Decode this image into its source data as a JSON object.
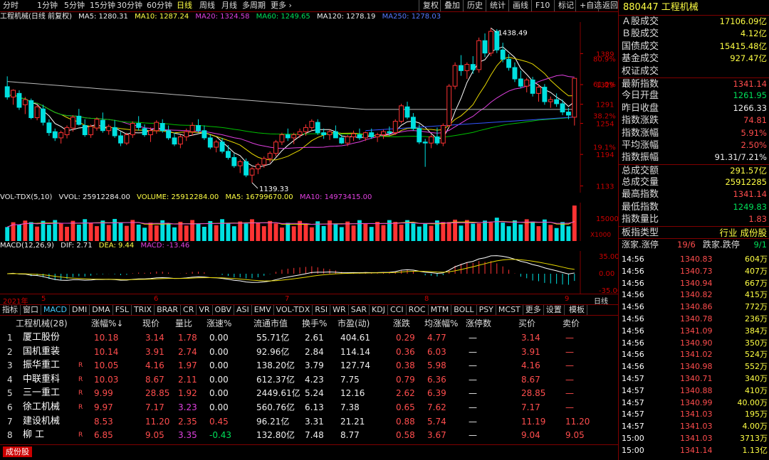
{
  "toolbar": {
    "periods": [
      "分时",
      "1分钟",
      "5分钟",
      "15分钟",
      "30分钟",
      "60分钟",
      "日线",
      "周线",
      "月线",
      "多周期",
      "更多 ›"
    ],
    "buttons": [
      "复权",
      "叠加",
      "历史",
      "统计",
      "画线",
      "F10",
      "标记",
      "+自选",
      "返回"
    ]
  },
  "kline": {
    "title": "工程机械(日线 前复权)",
    "ma5": "MA5: 1280.31",
    "ma10": "MA10: 1287.24",
    "ma20": "MA20: 1324.58",
    "ma60": "MA60: 1249.65",
    "ma120": "MA120: 1278.19",
    "ma250": "MA250: 1278.03",
    "high_label": "1438.49",
    "low_label": "1139.33",
    "price_axis": [
      "1389",
      "1329",
      "1291",
      "1254",
      "1194",
      "1133"
    ],
    "pct_axis": [
      "80.9%",
      "61.8%",
      "38.2%",
      "19.1%"
    ]
  },
  "volume": {
    "label": "VOL-TDX(5,10)",
    "vvol": "VVOL: 25912284.00",
    "volume": "VOLUME: 25912284.00",
    "ma5": "MA5: 16799670.00",
    "ma10": "MA10: 14973415.00",
    "axis": "15000",
    "unit": "X1000"
  },
  "macd": {
    "label": "MACD(12,26,9)",
    "dif": "DIF: 2.71",
    "dea": "DEA: 9.44",
    "macd": "MACD: -13.46",
    "axis": [
      "35.00",
      "0.00",
      "-35.00"
    ]
  },
  "date_axis": [
    "2021年",
    "5",
    "6",
    "7",
    "8",
    "9"
  ],
  "bottom_right_label": "日线",
  "indicator_tabs": [
    "指标",
    "窗口",
    "MACD",
    "DMI",
    "DMA",
    "FSL",
    "TRIX",
    "BRAR",
    "CR",
    "VR",
    "OBV",
    "ASI",
    "EMV",
    "VOL-TDX",
    "RSI",
    "WR",
    "SAR",
    "KDJ",
    "CCI",
    "ROC",
    "MTM",
    "BOLL",
    "PSY",
    "MCST",
    "更多",
    "设置"
  ],
  "indicator_tab_extra": "模板",
  "table": {
    "headers": [
      "工程机械(28)",
      "涨幅%↓",
      "现价",
      "量比",
      "涨速%",
      "流通市值",
      "换手%",
      "市盈(动)",
      "涨跌",
      "均涨幅%",
      "涨停数",
      "买价",
      "卖价"
    ],
    "rows": [
      {
        "no": "1",
        "name": "厦工股份",
        "r": "",
        "chg": "10.18",
        "price": "3.14",
        "vr": "1.78",
        "spd": "0.00",
        "cap": "55.71亿",
        "turn": "2.61",
        "pe": "404.61",
        "diff": "0.29",
        "avg": "4.77",
        "lim": "—",
        "bid": "3.14",
        "ask": "—"
      },
      {
        "no": "2",
        "name": "国机重装",
        "r": "",
        "chg": "10.14",
        "price": "3.91",
        "vr": "2.74",
        "spd": "0.00",
        "cap": "92.96亿",
        "turn": "2.84",
        "pe": "114.14",
        "diff": "0.36",
        "avg": "6.03",
        "lim": "—",
        "bid": "3.91",
        "ask": "—"
      },
      {
        "no": "3",
        "name": "振华重工",
        "r": "R",
        "chg": "10.05",
        "price": "4.16",
        "vr": "1.97",
        "spd": "0.00",
        "cap": "138.20亿",
        "turn": "3.79",
        "pe": "127.74",
        "diff": "0.38",
        "avg": "5.98",
        "lim": "—",
        "bid": "4.16",
        "ask": "—"
      },
      {
        "no": "4",
        "name": "中联重科",
        "r": "R",
        "chg": "10.03",
        "price": "8.67",
        "vr": "2.11",
        "spd": "0.00",
        "cap": "612.37亿",
        "turn": "4.23",
        "pe": "7.75",
        "diff": "0.79",
        "avg": "6.36",
        "lim": "—",
        "bid": "8.67",
        "ask": "—"
      },
      {
        "no": "5",
        "name": "三一重工",
        "r": "R",
        "chg": "9.99",
        "price": "28.85",
        "vr": "1.92",
        "spd": "0.00",
        "cap": "2449.61亿",
        "turn": "5.24",
        "pe": "12.16",
        "diff": "2.62",
        "avg": "6.39",
        "lim": "—",
        "bid": "28.85",
        "ask": "—"
      },
      {
        "no": "6",
        "name": "徐工机械",
        "r": "R",
        "chg": "9.97",
        "price": "7.17",
        "vr": "3.23",
        "spd": "0.00",
        "cap": "560.76亿",
        "turn": "6.13",
        "pe": "7.38",
        "diff": "0.65",
        "avg": "7.62",
        "lim": "—",
        "bid": "7.17",
        "ask": "—"
      },
      {
        "no": "7",
        "name": "建设机械",
        "r": "",
        "chg": "8.53",
        "price": "11.20",
        "vr": "2.35",
        "spd": "0.45",
        "cap": "96.21亿",
        "turn": "3.31",
        "pe": "21.21",
        "diff": "0.88",
        "avg": "5.74",
        "lim": "—",
        "bid": "11.19",
        "ask": "11.20"
      },
      {
        "no": "8",
        "name": "柳  工",
        "r": "R",
        "chg": "6.85",
        "price": "9.05",
        "vr": "3.35",
        "spd": "-0.43",
        "cap": "132.80亿",
        "turn": "7.48",
        "pe": "8.77",
        "diff": "0.58",
        "avg": "3.67",
        "lim": "—",
        "bid": "9.04",
        "ask": "9.05"
      }
    ]
  },
  "bottom_tag": "成份股",
  "right_panel": {
    "title": "880447 工程机械",
    "stats": [
      {
        "label": "Ａ股成交",
        "value": "17106.09亿",
        "color": "y"
      },
      {
        "label": "Ｂ股成交",
        "value": "4.12亿",
        "color": "y"
      },
      {
        "label": "国债成交",
        "value": "15415.48亿",
        "color": "y"
      },
      {
        "label": "基金成交",
        "value": "927.47亿",
        "color": "y"
      },
      {
        "label": "权证成交",
        "value": "",
        "color": "y"
      },
      {
        "label": "最新指数",
        "value": "1341.14",
        "color": "r"
      },
      {
        "label": "今日开盘",
        "value": "1261.95",
        "color": "g"
      },
      {
        "label": "昨日收盘",
        "value": "1266.33",
        "color": "w"
      },
      {
        "label": "指数涨跌",
        "value": "74.81",
        "color": "r"
      },
      {
        "label": "指数涨幅",
        "value": "5.91%",
        "color": "r"
      },
      {
        "label": "平均涨幅",
        "value": "2.50%",
        "color": "r"
      },
      {
        "label": "指数振幅",
        "value": "91.31/7.21%",
        "color": "w"
      },
      {
        "label": "总成交额",
        "value": "291.57亿",
        "color": "y"
      },
      {
        "label": "总成交量",
        "value": "25912285",
        "color": "y"
      },
      {
        "label": "最高指数",
        "value": "1341.14",
        "color": "r"
      },
      {
        "label": "最低指数",
        "value": "1249.83",
        "color": "g"
      },
      {
        "label": "指数量比",
        "value": "1.83",
        "color": "r"
      }
    ],
    "board_label": "板指类型",
    "board_value": "行业 成份股",
    "updown": {
      "up_label": "涨家.涨停",
      "up_value": "19/6",
      "down_label": "跌家.跌停",
      "down_value": "9/1"
    },
    "ticks": [
      {
        "time": "14:56",
        "price": "1340.83",
        "vol": "604万"
      },
      {
        "time": "14:56",
        "price": "1340.73",
        "vol": "407万"
      },
      {
        "time": "14:56",
        "price": "1340.94",
        "vol": "667万"
      },
      {
        "time": "14:56",
        "price": "1340.82",
        "vol": "415万"
      },
      {
        "time": "14:56",
        "price": "1340.86",
        "vol": "772万"
      },
      {
        "time": "14:56",
        "price": "1340.78",
        "vol": "236万"
      },
      {
        "time": "14:56",
        "price": "1341.09",
        "vol": "384万"
      },
      {
        "time": "14:56",
        "price": "1340.90",
        "vol": "350万"
      },
      {
        "time": "14:56",
        "price": "1341.02",
        "vol": "524万"
      },
      {
        "time": "14:56",
        "price": "1340.98",
        "vol": "552万"
      },
      {
        "time": "14:57",
        "price": "1340.71",
        "vol": "340万"
      },
      {
        "time": "14:57",
        "price": "1340.88",
        "vol": "410万"
      },
      {
        "time": "14:57",
        "price": "1340.99",
        "vol": "40.00万"
      },
      {
        "time": "14:57",
        "price": "1341.03",
        "vol": "195万"
      },
      {
        "time": "14:57",
        "price": "1341.03",
        "vol": "4.00万"
      },
      {
        "time": "15:00",
        "price": "1341.03",
        "vol": "3713万"
      },
      {
        "time": "15:00",
        "price": "1341.14",
        "vol": "1.13亿"
      }
    ]
  },
  "chart_data": {
    "type": "candlestick",
    "title": "工程机械(日线 前复权)",
    "ylim": [
      1120,
      1450
    ],
    "high": 1438.49,
    "low": 1139.33,
    "ohlc": [
      [
        1325,
        1345,
        1300,
        1305
      ],
      [
        1305,
        1320,
        1290,
        1318
      ],
      [
        1312,
        1318,
        1280,
        1285
      ],
      [
        1290,
        1305,
        1272,
        1300
      ],
      [
        1298,
        1302,
        1262,
        1265
      ],
      [
        1265,
        1290,
        1260,
        1286
      ],
      [
        1282,
        1290,
        1250,
        1256
      ],
      [
        1255,
        1262,
        1230,
        1236
      ],
      [
        1238,
        1244,
        1220,
        1226
      ],
      [
        1226,
        1240,
        1215,
        1236
      ],
      [
        1232,
        1250,
        1225,
        1246
      ],
      [
        1245,
        1270,
        1238,
        1266
      ],
      [
        1268,
        1282,
        1250,
        1252
      ],
      [
        1250,
        1262,
        1228,
        1232
      ],
      [
        1232,
        1252,
        1226,
        1248
      ],
      [
        1245,
        1266,
        1240,
        1262
      ],
      [
        1260,
        1275,
        1236,
        1240
      ],
      [
        1240,
        1252,
        1232,
        1248
      ],
      [
        1246,
        1260,
        1226,
        1230
      ],
      [
        1230,
        1238,
        1210,
        1216
      ],
      [
        1216,
        1236,
        1212,
        1232
      ],
      [
        1232,
        1258,
        1226,
        1254
      ],
      [
        1254,
        1268,
        1240,
        1246
      ],
      [
        1244,
        1252,
        1228,
        1232
      ],
      [
        1232,
        1246,
        1218,
        1240
      ],
      [
        1240,
        1260,
        1234,
        1256
      ],
      [
        1254,
        1262,
        1236,
        1240
      ],
      [
        1240,
        1250,
        1222,
        1226
      ],
      [
        1226,
        1236,
        1210,
        1214
      ],
      [
        1214,
        1232,
        1206,
        1228
      ],
      [
        1228,
        1244,
        1220,
        1238
      ],
      [
        1238,
        1256,
        1230,
        1250
      ],
      [
        1250,
        1262,
        1236,
        1240
      ],
      [
        1240,
        1250,
        1222,
        1226
      ],
      [
        1226,
        1232,
        1204,
        1208
      ],
      [
        1208,
        1222,
        1198,
        1218
      ],
      [
        1218,
        1226,
        1196,
        1200
      ],
      [
        1200,
        1212,
        1184,
        1188
      ],
      [
        1188,
        1196,
        1168,
        1172
      ],
      [
        1172,
        1184,
        1158,
        1180
      ],
      [
        1180,
        1186,
        1150,
        1154
      ],
      [
        1154,
        1170,
        1139.33,
        1166
      ],
      [
        1166,
        1178,
        1156,
        1174
      ],
      [
        1174,
        1190,
        1168,
        1186
      ],
      [
        1186,
        1200,
        1178,
        1196
      ],
      [
        1196,
        1222,
        1190,
        1218
      ],
      [
        1218,
        1236,
        1212,
        1232
      ],
      [
        1232,
        1244,
        1220,
        1226
      ],
      [
        1226,
        1236,
        1214,
        1232
      ],
      [
        1232,
        1244,
        1226,
        1238
      ],
      [
        1238,
        1252,
        1230,
        1246
      ],
      [
        1246,
        1262,
        1240,
        1258
      ],
      [
        1256,
        1262,
        1232,
        1236
      ],
      [
        1236,
        1244,
        1224,
        1232
      ],
      [
        1232,
        1242,
        1222,
        1238
      ],
      [
        1238,
        1250,
        1230,
        1226
      ],
      [
        1226,
        1232,
        1214,
        1216
      ],
      [
        1216,
        1232,
        1210,
        1228
      ],
      [
        1228,
        1240,
        1220,
        1234
      ],
      [
        1232,
        1244,
        1222,
        1226
      ],
      [
        1226,
        1238,
        1220,
        1236
      ],
      [
        1236,
        1244,
        1224,
        1228
      ],
      [
        1228,
        1236,
        1218,
        1232
      ],
      [
        1232,
        1242,
        1224,
        1238
      ],
      [
        1238,
        1248,
        1230,
        1236
      ],
      [
        1236,
        1262,
        1232,
        1258
      ],
      [
        1258,
        1292,
        1254,
        1288
      ],
      [
        1286,
        1296,
        1262,
        1266
      ],
      [
        1266,
        1274,
        1240,
        1244
      ],
      [
        1244,
        1252,
        1214,
        1218
      ],
      [
        1218,
        1224,
        1170,
        1216
      ],
      [
        1216,
        1232,
        1206,
        1228
      ],
      [
        1228,
        1246,
        1212,
        1216
      ],
      [
        1216,
        1254,
        1210,
        1250
      ],
      [
        1250,
        1330,
        1246,
        1326
      ],
      [
        1326,
        1372,
        1320,
        1366
      ],
      [
        1366,
        1386,
        1346,
        1356
      ],
      [
        1356,
        1372,
        1340,
        1368
      ],
      [
        1368,
        1384,
        1350,
        1358
      ],
      [
        1358,
        1420,
        1352,
        1414
      ],
      [
        1414,
        1428,
        1382,
        1390
      ],
      [
        1390,
        1438.49,
        1384,
        1432
      ],
      [
        1432,
        1436,
        1390,
        1396
      ],
      [
        1396,
        1410,
        1372,
        1378
      ],
      [
        1378,
        1388,
        1356,
        1362
      ],
      [
        1362,
        1372,
        1334,
        1340
      ],
      [
        1340,
        1356,
        1322,
        1326
      ],
      [
        1326,
        1342,
        1314,
        1338
      ],
      [
        1338,
        1344,
        1306,
        1312
      ],
      [
        1312,
        1330,
        1296,
        1324
      ],
      [
        1324,
        1330,
        1290,
        1296
      ],
      [
        1296,
        1306,
        1284,
        1300
      ],
      [
        1300,
        1312,
        1286,
        1292
      ],
      [
        1292,
        1300,
        1270,
        1276
      ],
      [
        1276,
        1284,
        1262,
        1270
      ],
      [
        1266,
        1341.14,
        1249.83,
        1341.14
      ]
    ]
  }
}
